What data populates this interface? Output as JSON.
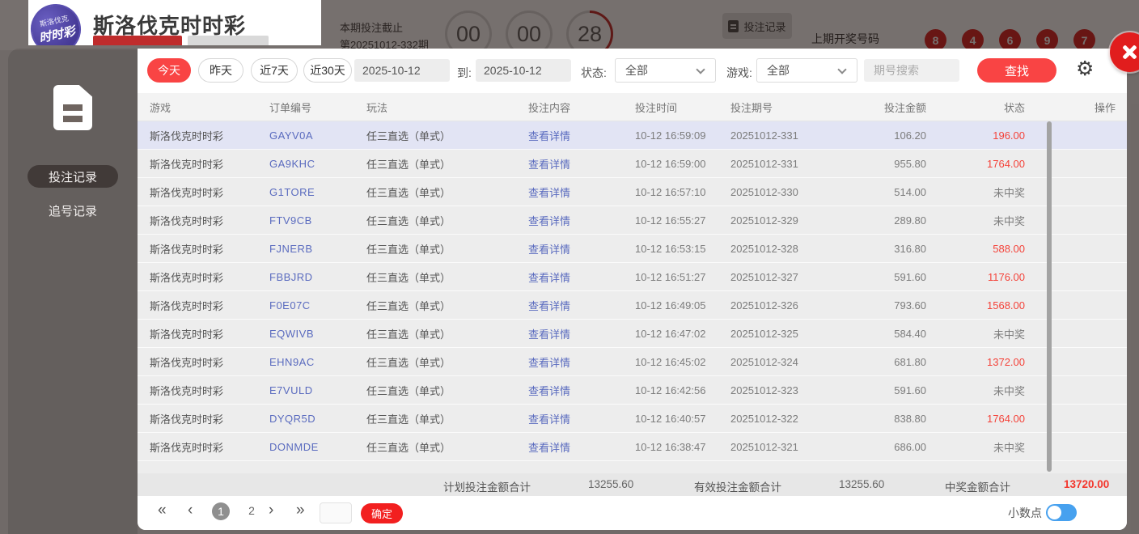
{
  "header": {
    "title": "斯洛伐克时时彩",
    "deadline_label": "本期投注截止",
    "period_label": "第20251012-332期",
    "countdown": [
      "00",
      "00",
      "28"
    ],
    "record_button": "投注记录",
    "last_draw_label": "上期开奖号码",
    "last_draw_numbers": [
      "8",
      "4",
      "6",
      "9",
      "7"
    ]
  },
  "sidebar": {
    "items": [
      {
        "label": "投注记录",
        "active": true
      },
      {
        "label": "追号记录",
        "active": false
      }
    ]
  },
  "filters": {
    "quick": [
      {
        "label": "今天",
        "active": true
      },
      {
        "label": "昨天",
        "active": false
      },
      {
        "label": "近7天",
        "active": false
      },
      {
        "label": "近30天",
        "active": false
      }
    ],
    "date_from": "2025-10-12",
    "to_label": "到:",
    "date_to": "2025-10-12",
    "status_label": "状态:",
    "status_value": "全部",
    "game_label": "游戏:",
    "game_value": "全部",
    "search_placeholder": "期号搜索",
    "search_button": "查找"
  },
  "table": {
    "headers": [
      "游戏",
      "订单编号",
      "玩法",
      "投注内容",
      "投注时间",
      "投注期号",
      "投注金额",
      "状态",
      "操作"
    ],
    "rows": [
      {
        "game": "斯洛伐克时时彩",
        "order": "GAYV0A",
        "play": "任三直选（单式）",
        "detail": "查看详情",
        "time": "10-12 16:59:09",
        "period": "20251012-331",
        "amount": "106.20",
        "status": "196.00",
        "win": true,
        "highlight": true
      },
      {
        "game": "斯洛伐克时时彩",
        "order": "GA9KHC",
        "play": "任三直选（单式）",
        "detail": "查看详情",
        "time": "10-12 16:59:00",
        "period": "20251012-331",
        "amount": "955.80",
        "status": "1764.00",
        "win": true,
        "highlight": false
      },
      {
        "game": "斯洛伐克时时彩",
        "order": "G1TORE",
        "play": "任三直选（单式）",
        "detail": "查看详情",
        "time": "10-12 16:57:10",
        "period": "20251012-330",
        "amount": "514.00",
        "status": "未中奖",
        "win": false,
        "highlight": false
      },
      {
        "game": "斯洛伐克时时彩",
        "order": "FTV9CB",
        "play": "任三直选（单式）",
        "detail": "查看详情",
        "time": "10-12 16:55:27",
        "period": "20251012-329",
        "amount": "289.80",
        "status": "未中奖",
        "win": false,
        "highlight": false
      },
      {
        "game": "斯洛伐克时时彩",
        "order": "FJNERB",
        "play": "任三直选（单式）",
        "detail": "查看详情",
        "time": "10-12 16:53:15",
        "period": "20251012-328",
        "amount": "316.80",
        "status": "588.00",
        "win": true,
        "highlight": false
      },
      {
        "game": "斯洛伐克时时彩",
        "order": "FBBJRD",
        "play": "任三直选（单式）",
        "detail": "查看详情",
        "time": "10-12 16:51:27",
        "period": "20251012-327",
        "amount": "591.60",
        "status": "1176.00",
        "win": true,
        "highlight": false
      },
      {
        "game": "斯洛伐克时时彩",
        "order": "F0E07C",
        "play": "任三直选（单式）",
        "detail": "查看详情",
        "time": "10-12 16:49:05",
        "period": "20251012-326",
        "amount": "793.60",
        "status": "1568.00",
        "win": true,
        "highlight": false
      },
      {
        "game": "斯洛伐克时时彩",
        "order": "EQWIVB",
        "play": "任三直选（单式）",
        "detail": "查看详情",
        "time": "10-12 16:47:02",
        "period": "20251012-325",
        "amount": "584.40",
        "status": "未中奖",
        "win": false,
        "highlight": false
      },
      {
        "game": "斯洛伐克时时彩",
        "order": "EHN9AC",
        "play": "任三直选（单式）",
        "detail": "查看详情",
        "time": "10-12 16:45:02",
        "period": "20251012-324",
        "amount": "681.80",
        "status": "1372.00",
        "win": true,
        "highlight": false
      },
      {
        "game": "斯洛伐克时时彩",
        "order": "E7VULD",
        "play": "任三直选（单式）",
        "detail": "查看详情",
        "time": "10-12 16:42:56",
        "period": "20251012-323",
        "amount": "591.60",
        "status": "未中奖",
        "win": false,
        "highlight": false
      },
      {
        "game": "斯洛伐克时时彩",
        "order": "DYQR5D",
        "play": "任三直选（单式）",
        "detail": "查看详情",
        "time": "10-12 16:40:57",
        "period": "20251012-322",
        "amount": "838.80",
        "status": "1764.00",
        "win": true,
        "highlight": false
      },
      {
        "game": "斯洛伐克时时彩",
        "order": "DONMDE",
        "play": "任三直选（单式）",
        "detail": "查看详情",
        "time": "10-12 16:38:47",
        "period": "20251012-321",
        "amount": "686.00",
        "status": "未中奖",
        "win": false,
        "highlight": false
      }
    ]
  },
  "totals": {
    "plan_label": "计划投注金额合计",
    "plan_value": "13255.60",
    "valid_label": "有效投注金额合计",
    "valid_value": "13255.60",
    "win_label": "中奖金额合计",
    "win_value": "13720.00"
  },
  "pagination": {
    "pages": [
      "1",
      "2"
    ],
    "current": "1",
    "confirm_button": "确定"
  },
  "footer": {
    "decimal_label": "小数点",
    "toggle_on": true
  },
  "colors": {
    "accent_red": "#f94444",
    "win_red": "#f4433a",
    "link_blue": "#5a6bbf",
    "ball_red": "#dc1f1f",
    "toggle_blue": "#47a1ef"
  }
}
